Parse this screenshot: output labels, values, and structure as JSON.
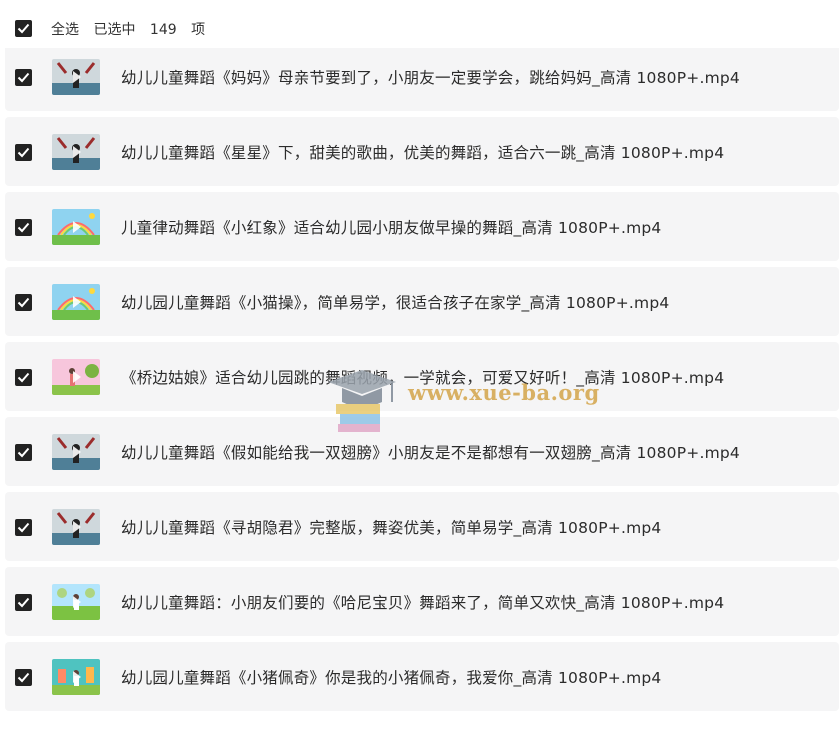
{
  "header": {
    "select_all_label": "全选",
    "selected_label": "已选中",
    "selected_count": "149",
    "unit_label": "项"
  },
  "watermark": {
    "text": "www.xue-ba.org"
  },
  "items": [
    {
      "title": "",
      "thumb": "green-field"
    },
    {
      "title": "幼儿儿童舞蹈《妈妈》母亲节要到了，小朋友一定要学会，跳给妈妈_高清 1080P+.mp4",
      "thumb": "stage"
    },
    {
      "title": "幼儿儿童舞蹈《星星》下，甜美的歌曲，优美的舞蹈，适合六一跳_高清 1080P+.mp4",
      "thumb": "stage"
    },
    {
      "title": "儿童律动舞蹈《小红象》适合幼儿园小朋友做早操的舞蹈_高清 1080P+.mp4",
      "thumb": "rainbow"
    },
    {
      "title": "幼儿园儿童舞蹈《小猫操》，简单易学，很适合孩子在家学_高清 1080P+.mp4",
      "thumb": "rainbow"
    },
    {
      "title": "《桥边姑娘》适合幼儿园跳的舞蹈视频，一学就会，可爱又好听！_高清 1080P+.mp4",
      "thumb": "pink"
    },
    {
      "title": "幼儿儿童舞蹈《假如能给我一双翅膀》小朋友是不是都想有一双翅膀_高清 1080P+.mp4",
      "thumb": "stage"
    },
    {
      "title": "幼儿儿童舞蹈《寻胡隐君》完整版，舞姿优美，简单易学_高清 1080P+.mp4",
      "thumb": "stage"
    },
    {
      "title": "幼儿儿童舞蹈：小朋友们要的《哈尼宝贝》舞蹈来了，简单又欢快_高清 1080P+.mp4",
      "thumb": "green-field"
    },
    {
      "title": "幼儿园儿童舞蹈《小猪佩奇》你是我的小猪佩奇，我爱你_高清 1080P+.mp4",
      "thumb": "teal"
    }
  ]
}
